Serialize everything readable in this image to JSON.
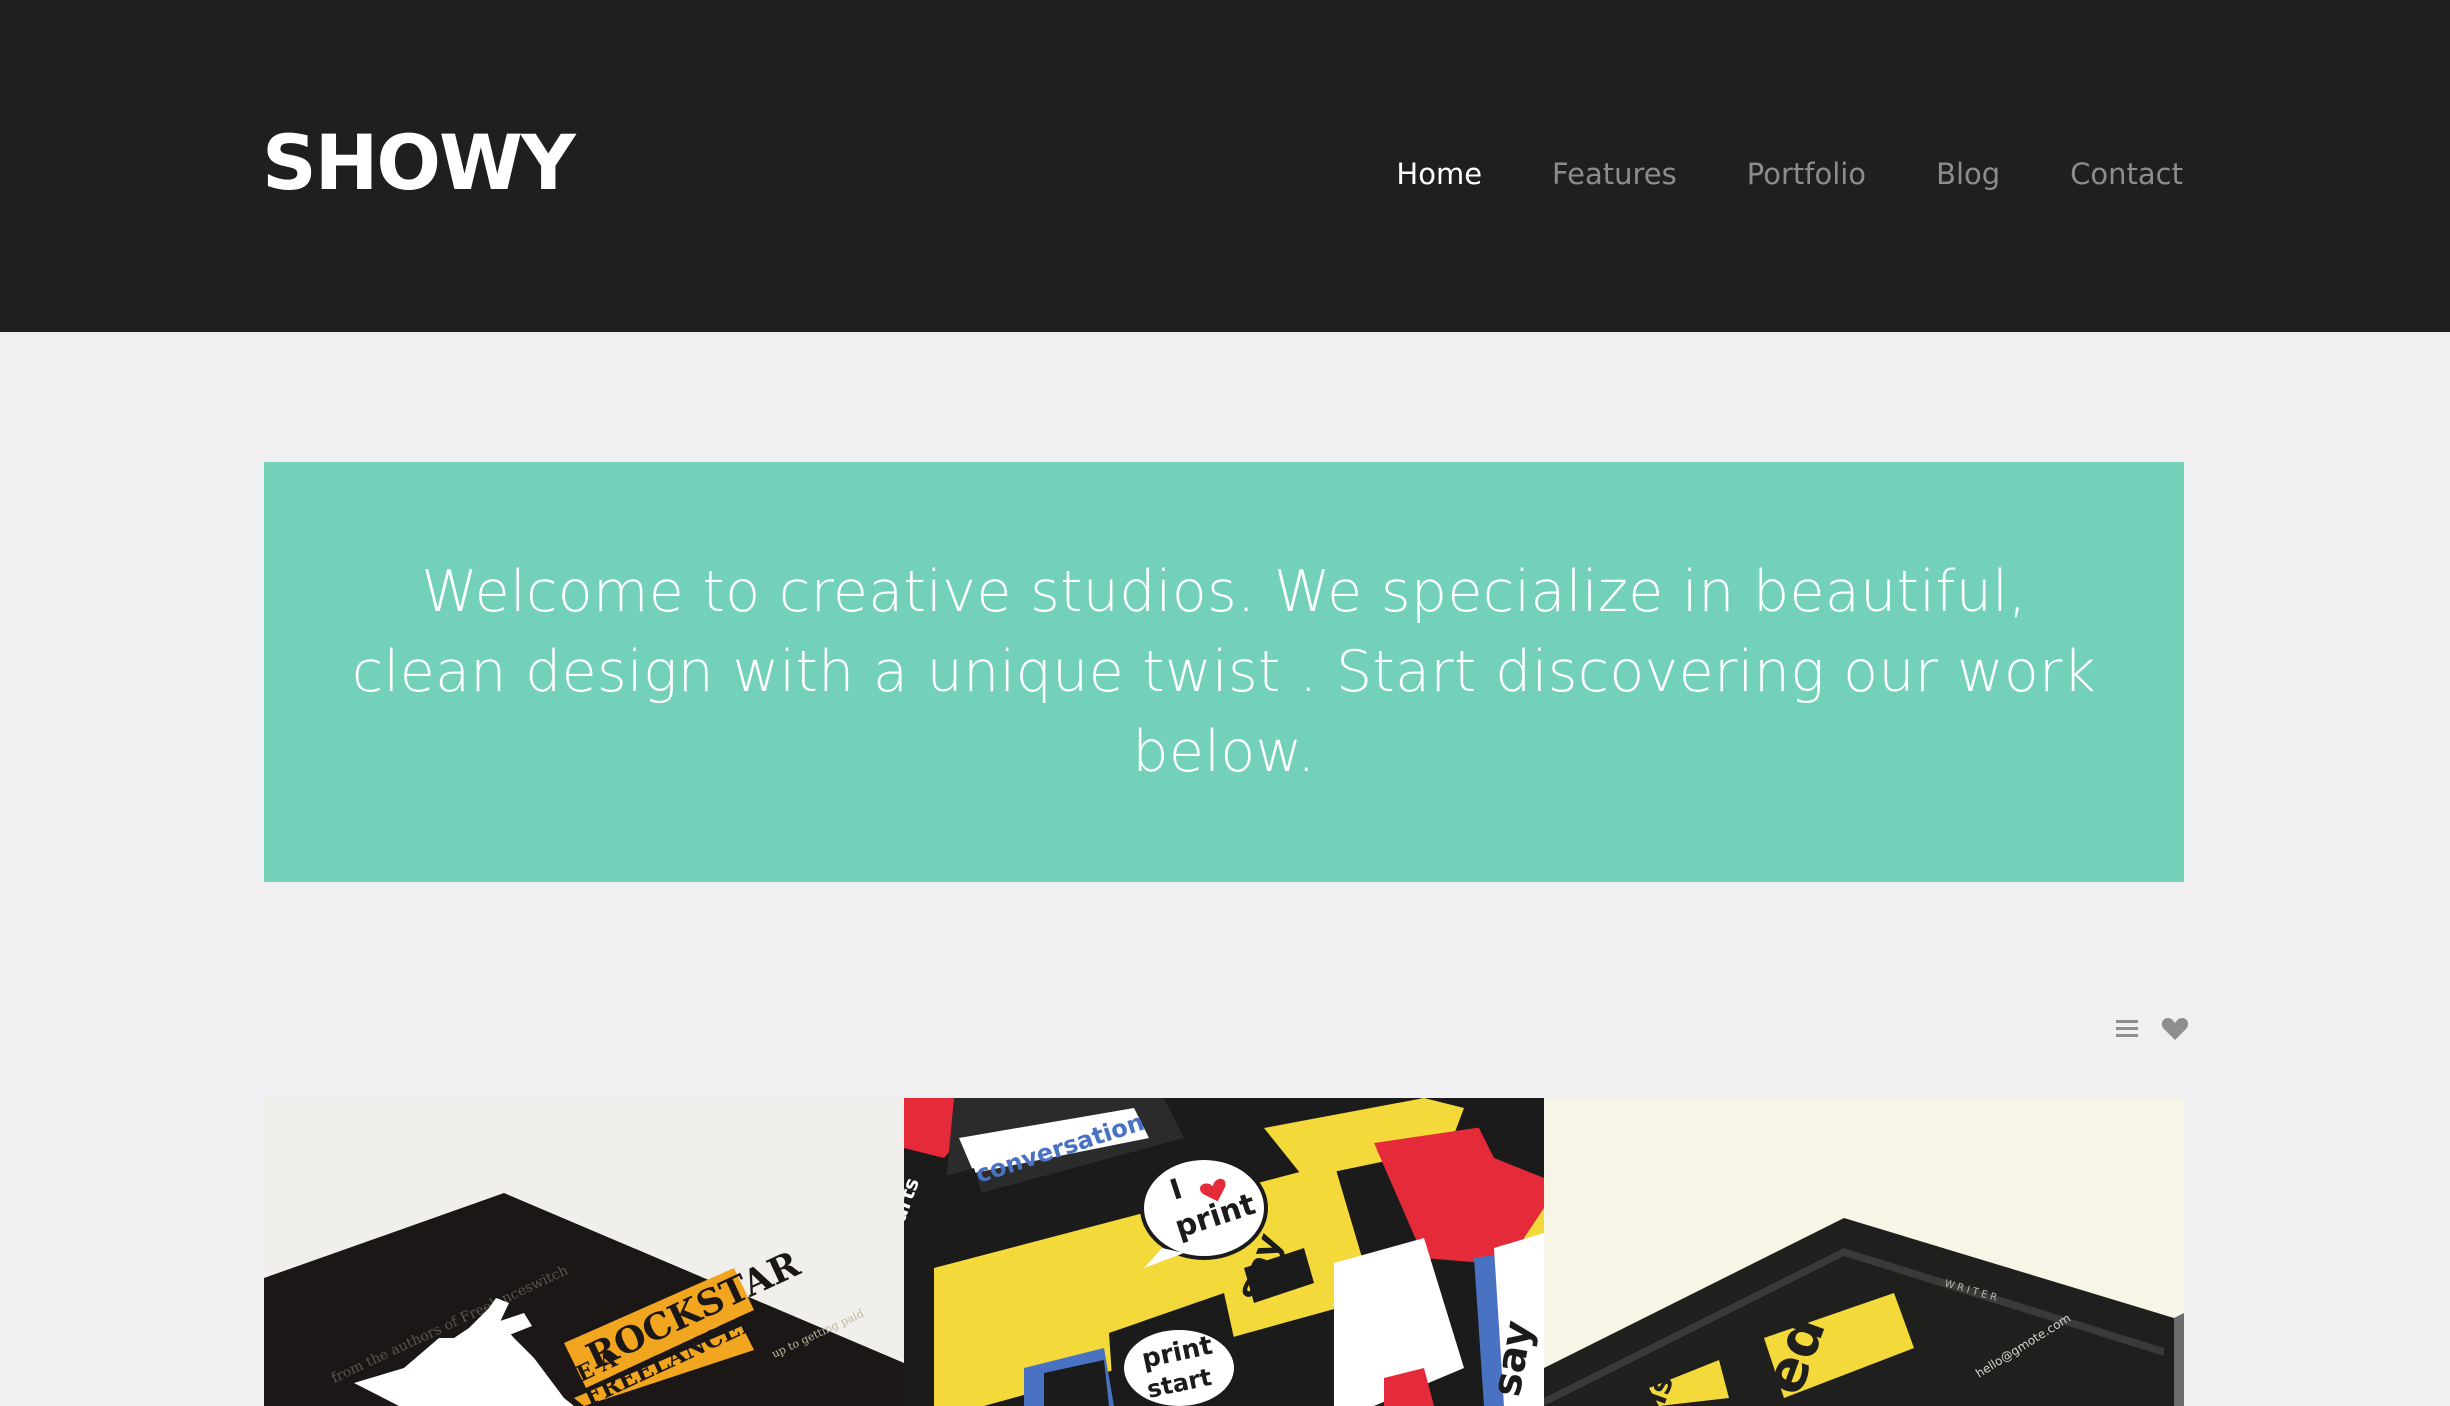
{
  "header": {
    "logo": "SHOWY",
    "nav": [
      {
        "label": "Home",
        "active": true
      },
      {
        "label": "Features",
        "active": false
      },
      {
        "label": "Portfolio",
        "active": false
      },
      {
        "label": "Blog",
        "active": false
      },
      {
        "label": "Contact",
        "active": false
      }
    ]
  },
  "hero": {
    "text": "Welcome to creative studios. We specialize in beautiful, clean design with a unique twist . Start discovering our work below.",
    "color": "#73d1b9"
  },
  "tools": {
    "icons": [
      "list-icon",
      "heart-icon"
    ]
  },
  "gallery": {
    "tiles": [
      {
        "name": "portfolio-item-rockstar-freelancer",
        "texts": {
          "a": "from the authors of Freelanceswitch",
          "b": "BE A",
          "c": "ROCKSTAR",
          "d": "FREELANCER",
          "e": "up to getting paid"
        }
      },
      {
        "name": "portfolio-item-i-love-print",
        "texts": {
          "a": "conversation",
          "b": "I",
          "c": "print",
          "d": "say",
          "e": "print",
          "f": "start",
          "g": "art",
          "h": "arts",
          "i": "say"
        }
      },
      {
        "name": "portfolio-item-business-cards",
        "texts": {
          "a": "WRITER",
          "b": "is",
          "c": "ed",
          "d": "hello@gmote.com"
        }
      }
    ]
  }
}
